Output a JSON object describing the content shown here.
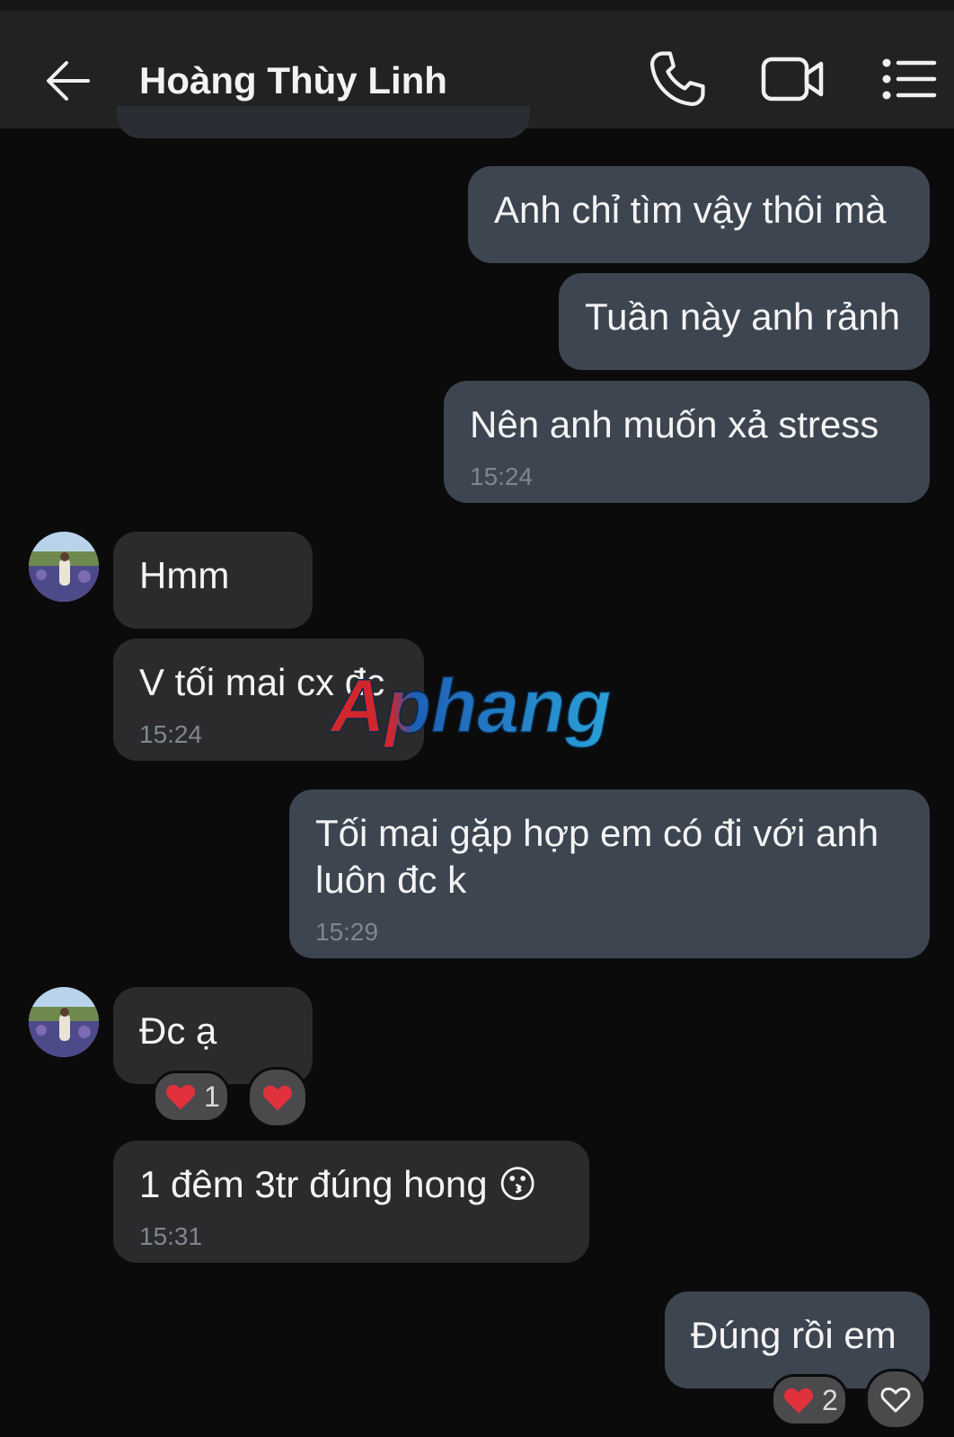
{
  "header": {
    "contact_name": "Hoàng Thùy Linh",
    "icons": [
      "back-arrow-icon",
      "phone-icon",
      "video-camera-icon",
      "menu-list-icon"
    ]
  },
  "messages": [
    {
      "side": "out",
      "text": "Anh chỉ tìm vậy thôi mà"
    },
    {
      "side": "out",
      "text": "Tuần này anh rảnh"
    },
    {
      "side": "out",
      "text": "Nên anh muốn xả stress",
      "time": "15:24"
    },
    {
      "side": "in",
      "text": "Hmm"
    },
    {
      "side": "in",
      "text": "V tối mai cx đc",
      "time": "15:24"
    },
    {
      "side": "out",
      "text": "Tối mai gặp hợp em có đi với anh luôn đc k",
      "time": "15:29"
    },
    {
      "side": "in",
      "text": "Đc ạ",
      "reactions": {
        "heart_count": "1"
      }
    },
    {
      "side": "in",
      "text": "1 đêm 3tr đúng hong 😗",
      "time": "15:31"
    },
    {
      "side": "out",
      "text": "Đúng rồi em",
      "reactions": {
        "heart_count": "2"
      }
    }
  ],
  "watermark": {
    "text": "Aphang"
  },
  "colors": {
    "background": "#0b0b0c",
    "header": "#222222",
    "outgoing_bubble": "#3d4551",
    "incoming_bubble": "#2b2b2d",
    "timestamp": "#7f8690",
    "heart": "#e0313c"
  }
}
